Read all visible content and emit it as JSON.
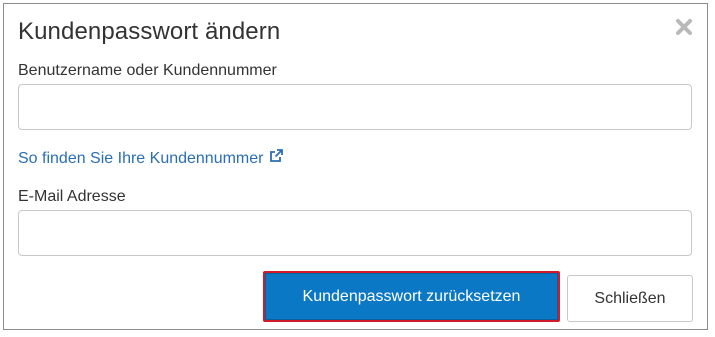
{
  "dialog": {
    "title": "Kundenpasswort ändern",
    "close_icon": "close-icon",
    "username_field": {
      "label": "Benutzername oder Kundennummer",
      "value": "",
      "placeholder": ""
    },
    "help_link": {
      "text": "So finden Sie Ihre Kundennummer",
      "icon": "external-link-icon"
    },
    "email_field": {
      "label": "E-Mail Adresse",
      "value": "",
      "placeholder": ""
    },
    "buttons": {
      "reset_label": "Kundenpasswort zurücksetzen",
      "close_label": "Schließen"
    },
    "colors": {
      "primary": "#0a78c4",
      "link": "#2a6fb5",
      "highlight_border": "#d11a2a"
    }
  }
}
